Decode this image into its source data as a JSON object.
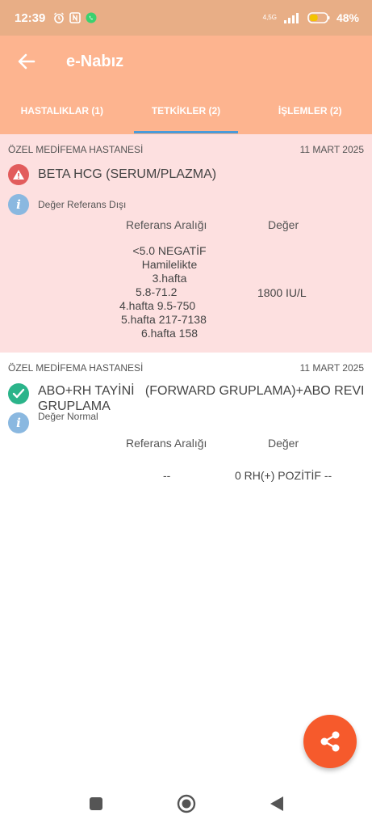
{
  "status_bar": {
    "time": "12:39",
    "signal_label": "4,5G",
    "battery_percent": "48",
    "battery_level": 0.48
  },
  "app_bar": {
    "title": "e-Nabız",
    "back_icon": "back-arrow-icon"
  },
  "tabs": [
    {
      "label": "HASTALIKLAR (1)",
      "active": false
    },
    {
      "label": "TETKİKLER (2)",
      "active": true
    },
    {
      "label": "İŞLEMLER (2)",
      "active": false
    }
  ],
  "colors": {
    "accent": "#fdb48f",
    "status_bar": "#e8ae86",
    "tab_indicator": "#4a9ad9",
    "abnormal_bg": "#fde0e0",
    "fab": "#f65a2c",
    "warning": "#e25c5c",
    "normal": "#2bb48a"
  },
  "tests": [
    {
      "hospital": "ÖZEL MEDİFEMA HASTANESİ",
      "date": "11 MART 2025",
      "name": "BETA HCG (SERUM/PLAZMA)",
      "status_icon": "warning-icon",
      "status_text": "Değer Referans Dışı",
      "ref_header": "Referans Aralığı",
      "value_header": "Değer",
      "reference_lines": [
        "<5.0 NEGATİF",
        "Hamilelikte",
        "3.hafta",
        "5.8-71.2",
        "4.hafta 9.5-750",
        "5.hafta 217-7138",
        "6.hafta 158"
      ],
      "value": "1800 IU/L"
    },
    {
      "hospital": "ÖZEL MEDİFEMA HASTANESİ",
      "date": "11 MART 2025",
      "name_line1": "ABO+RH TAYİNİ   (FORWARD GRUPLAMA)+ABO REVERS",
      "name_line2": "GRUPLAMA",
      "status_icon": "check-icon",
      "status_text": "Değer Normal",
      "ref_header": "Referans Aralığı",
      "value_header": "Değer",
      "reference": "--",
      "value": "0 RH(+) POZİTİF --"
    }
  ],
  "fab": {
    "icon": "share-icon"
  },
  "nav": {
    "recents_icon": "square-icon",
    "home_icon": "home-circle-icon",
    "back_icon": "triangle-back-icon"
  }
}
